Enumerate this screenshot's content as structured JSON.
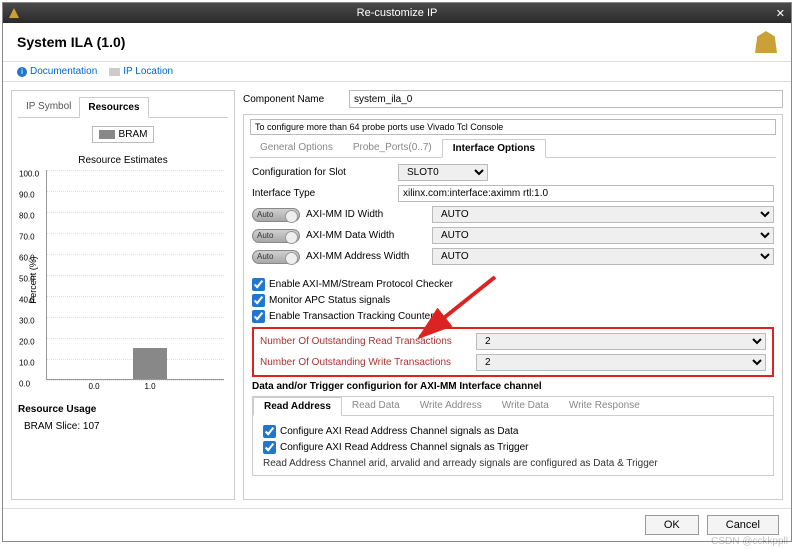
{
  "window": {
    "title": "Re-customize IP"
  },
  "header": {
    "title": "System ILA (1.0)"
  },
  "toolbar": {
    "doc": "Documentation",
    "iploc": "IP Location"
  },
  "left": {
    "tabs": [
      "IP Symbol",
      "Resources"
    ],
    "legend": "BRAM",
    "chart_title": "Resource Estimates",
    "ylabel": "Percent (%)",
    "usage_title": "Resource Usage",
    "usage_line": "BRAM Slice: 107"
  },
  "chart_data": {
    "type": "bar",
    "categories": [
      "0.0",
      "1.0"
    ],
    "values": [
      0,
      15
    ],
    "ylabel": "Percent (%)",
    "ylim": [
      0,
      100
    ],
    "yticks": [
      0,
      10,
      20,
      30,
      40,
      50,
      60,
      70,
      80,
      90,
      100
    ]
  },
  "form": {
    "component_name_label": "Component Name",
    "component_name": "system_ila_0",
    "hint": "To configure more than 64 probe ports use Vivado Tcl Console",
    "tabs": [
      "General Options",
      "Probe_Ports(0..7)",
      "Interface Options"
    ],
    "slot_label": "Configuration for Slot",
    "slot": "SLOT0",
    "iftype_label": "Interface Type",
    "iftype": "xilinx.com:interface:aximm rtl:1.0",
    "auto": "Auto",
    "auto_val": "AUTO",
    "idw": "AXI-MM ID Width",
    "dw": "AXI-MM Data Width",
    "aw": "AXI-MM Address Width",
    "chk1": "Enable AXI-MM/Stream Protocol Checker",
    "chk2": "Monitor APC Status signals",
    "chk3": "Enable Transaction Tracking Counters",
    "nread_label": "Number Of Outstanding Read Transactions",
    "nread": "2",
    "nwrite_label": "Number Of Outstanding Write Transactions",
    "nwrite": "2",
    "trig_note": "Data and/or Trigger configurion for AXI-MM Interface channel",
    "subtabs": [
      "Read Address",
      "Read Data",
      "Write Address",
      "Write Data",
      "Write Response"
    ],
    "schk1": "Configure AXI Read Address Channel signals as Data",
    "schk2": "Configure AXI Read Address Channel signals as Trigger",
    "snote": "Read Address Channel arid, arvalid and arready signals are configured as Data & Trigger"
  },
  "footer": {
    "ok": "OK",
    "cancel": "Cancel"
  },
  "watermark": "CSDN @cckkppll"
}
